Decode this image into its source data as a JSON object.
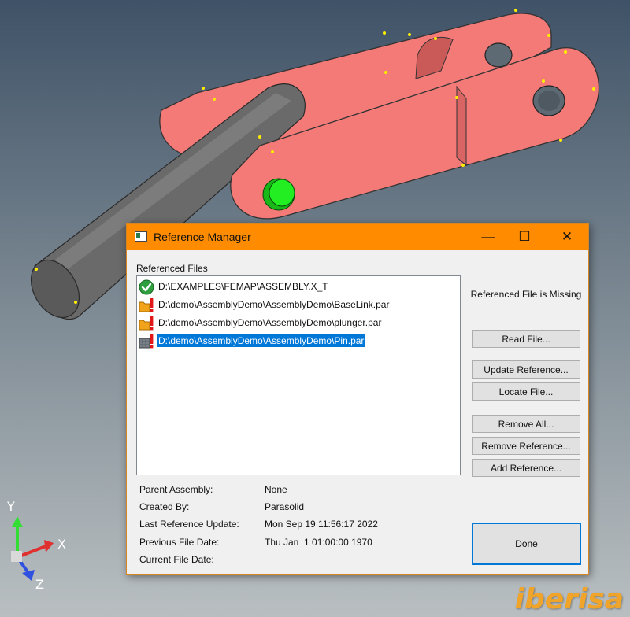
{
  "dialog": {
    "title": "Reference Manager",
    "controls": {
      "minimize": "—",
      "maximize": "☐",
      "close": "✕"
    },
    "referenced_files_label": "Referenced Files",
    "files": [
      {
        "path": "D:\\EXAMPLES\\FEMAP\\ASSEMBLY.X_T",
        "icon": "check-ok-icon",
        "selected": false
      },
      {
        "path": "D:\\demo\\AssemblyDemo\\AssemblyDemo\\BaseLink.par",
        "icon": "missing-file-warning-icon",
        "selected": false
      },
      {
        "path": "D:\\demo\\AssemblyDemo\\AssemblyDemo\\plunger.par",
        "icon": "missing-file-warning-icon",
        "selected": false
      },
      {
        "path": "D:\\demo\\AssemblyDemo\\AssemblyDemo\\Pin.par",
        "icon": "missing-part-warning-icon",
        "selected": true
      }
    ],
    "status_text": "Referenced File is Missing",
    "buttons": {
      "read_file": "Read File...",
      "update_reference": "Update Reference...",
      "locate_file": "Locate File...",
      "remove_all": "Remove All...",
      "remove_reference": "Remove Reference...",
      "add_reference": "Add Reference...",
      "done": "Done"
    },
    "info": {
      "parent_assembly_label": "Parent Assembly:",
      "parent_assembly_value": "None",
      "created_by_label": "Created By:",
      "created_by_value": "Parasolid",
      "last_update_label": "Last Reference Update:",
      "last_update_value": "Mon Sep 19 11:56:17 2022",
      "prev_date_label": "Previous File Date:",
      "prev_date_value": "Thu Jan  1 01:00:00 1970",
      "current_date_label": "Current File Date:",
      "current_date_value": ""
    }
  },
  "axes": {
    "x": "X",
    "y": "Y",
    "z": "Z"
  },
  "brand": "iberisa",
  "colors": {
    "title_bar": "#ff8c00",
    "part_color": "#f47a78",
    "pin_color": "#22dd22",
    "selection": "#0078d7",
    "brand": "#f0a52a"
  }
}
